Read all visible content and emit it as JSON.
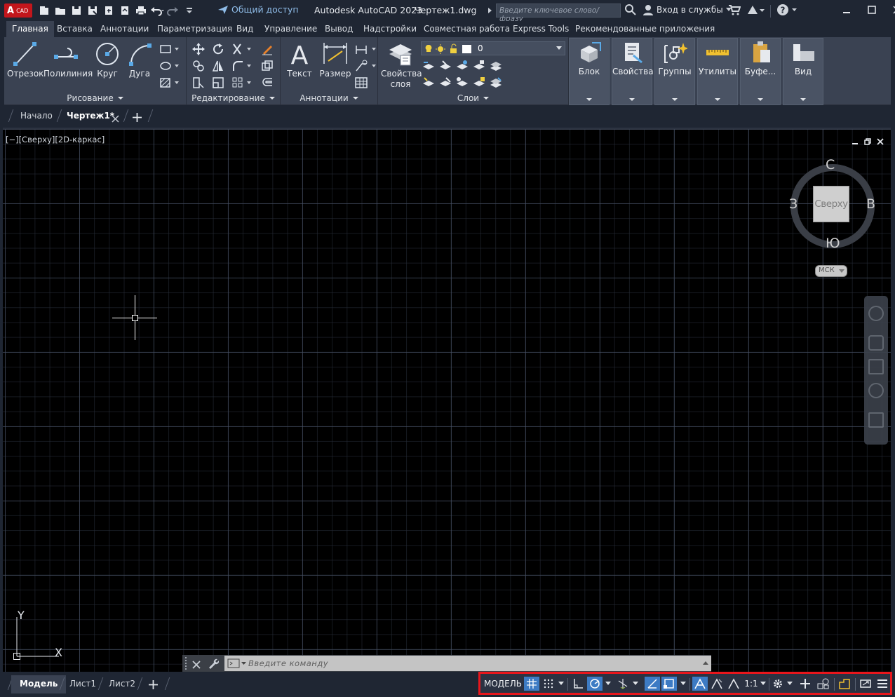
{
  "titlebar": {
    "logo_letter": "A",
    "logo_sub": "CAD",
    "share_label": "Общий доступ",
    "app_title": "Autodesk AutoCAD 2023",
    "file_name": "Чертеж1.dwg",
    "search_placeholder": "Введите ключевое слово/фразу",
    "signin_label": "Вход в службы"
  },
  "ribbon_tabs": [
    "Главная",
    "Вставка",
    "Аннотации",
    "Параметризация",
    "Вид",
    "Управление",
    "Вывод",
    "Надстройки",
    "Совместная работа",
    "Express Tools",
    "Рекомендованные приложения"
  ],
  "panels": {
    "draw": {
      "title": "Рисование",
      "tools": [
        "Отрезок",
        "Полилиния",
        "Круг",
        "Дуга"
      ]
    },
    "modify": {
      "title": "Редактирование"
    },
    "annotation": {
      "title": "Аннотации",
      "tools": [
        "Текст",
        "Размер"
      ]
    },
    "layers": {
      "title": "Слои",
      "props_line1": "Свойства",
      "props_line2": "слоя",
      "current_layer": "0"
    },
    "block": "Блок",
    "properties": "Свойства",
    "groups": "Группы",
    "utilities": "Утилиты",
    "clipboard": "Буфе...",
    "view": "Вид"
  },
  "file_tabs": {
    "start": "Начало",
    "drawing": "Чертеж1*"
  },
  "viewport": {
    "label": "[−][Сверху][2D-каркас]",
    "viewcube_face": "Сверху",
    "dir_n": "С",
    "dir_s": "Ю",
    "dir_w": "З",
    "dir_e": "В",
    "ucs_button": "МСК",
    "axis_x": "X",
    "axis_y": "Y"
  },
  "command": {
    "placeholder": "Введите  команду"
  },
  "layout_tabs": [
    "Модель",
    "Лист1",
    "Лист2"
  ],
  "status": {
    "model_label": "МОДЕЛЬ",
    "scale_label": "1:1"
  },
  "colors": {
    "accent": "#3d7bc4",
    "highlight_frame": "#e8161c",
    "logo": "#c3161c"
  }
}
